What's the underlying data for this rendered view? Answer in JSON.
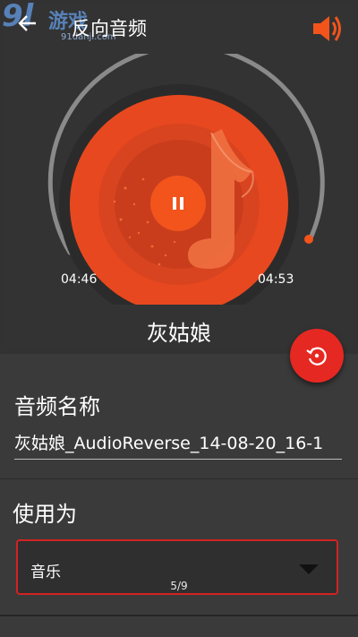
{
  "header": {
    "title": "反向音频",
    "back_icon": "arrow-left-icon",
    "volume_icon": "speaker-icon"
  },
  "watermark": {
    "logo": "9l",
    "text": "游戏",
    "url": "91danji.com"
  },
  "player": {
    "elapsed": "04:46",
    "total": "04:53",
    "song_title": "灰姑娘",
    "progress": 0.976,
    "play_state_icon": "pause-icon",
    "action_icon": "reverse-replay-icon"
  },
  "form": {
    "name_label": "音频名称",
    "name_value": "灰姑娘_AudioReverse_14-08-20_16-1",
    "use_label": "使用为",
    "use_selected": "音乐"
  },
  "page_indicator": "5/9",
  "colors": {
    "accent": "#f2541c",
    "fab": "#e62822",
    "select_border": "#d32222"
  }
}
